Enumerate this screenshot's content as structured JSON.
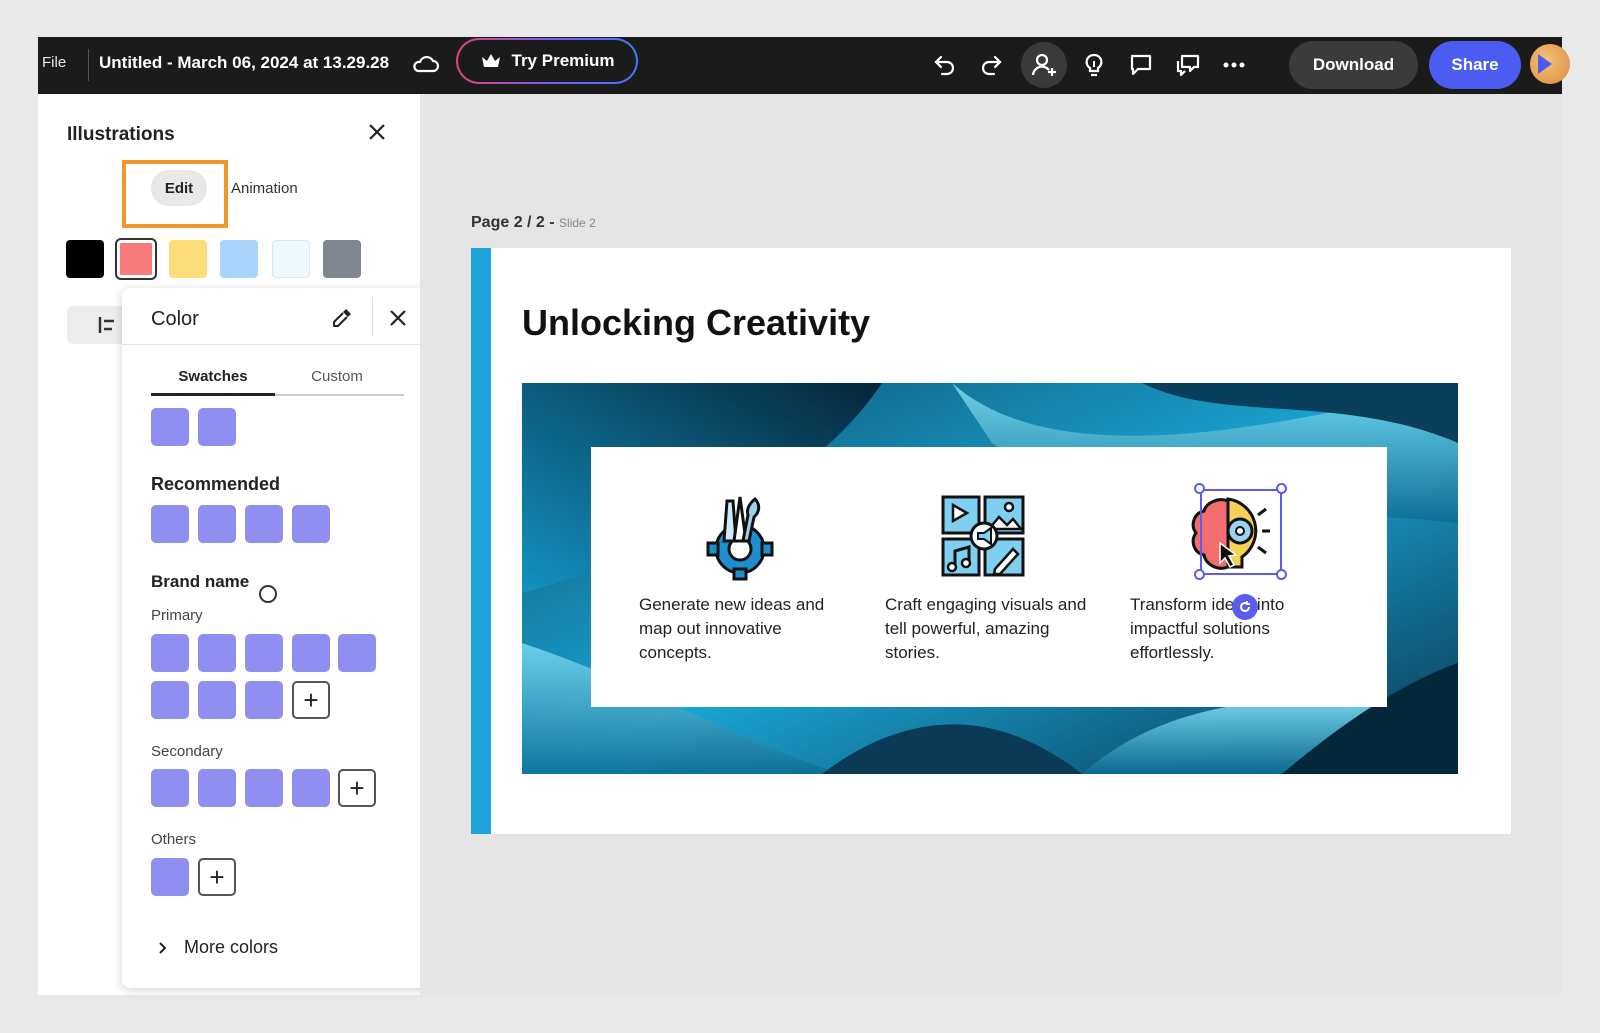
{
  "topbar": {
    "file_label": "File",
    "doc_title": "Untitled - March 06, 2024 at 13.29.28",
    "premium_label": "Try Premium",
    "download_label": "Download",
    "share_label": "Share",
    "icons": [
      "cloud-icon",
      "crown-icon",
      "undo-icon",
      "redo-icon",
      "invite-person-icon",
      "lightbulb-icon",
      "comment-icon",
      "chat-icon",
      "more-icon",
      "avatar"
    ]
  },
  "left_panel": {
    "title": "Illustrations",
    "tabs": {
      "edit": "Edit",
      "animation": "Animation"
    },
    "swatches": [
      "#000000",
      "#f77b7b",
      "#fcdd7a",
      "#a8d4fb",
      "#eef9fb",
      "#808790"
    ],
    "selected_swatch_index": 1,
    "highlight_color": "#f0962a"
  },
  "color_popup": {
    "title": "Color",
    "tabs": [
      "Swatches",
      "Custom"
    ],
    "active_tab": "Swatches",
    "swatch_color": "#8f8ff2",
    "recent_count": 2,
    "recommended": {
      "label": "Recommended",
      "count": 4
    },
    "brand": {
      "label": "Brand name",
      "primary": {
        "label": "Primary",
        "count": 8
      },
      "secondary": {
        "label": "Secondary",
        "count": 4
      },
      "others": {
        "label": "Others",
        "count": 1
      }
    },
    "more_colors": "More colors"
  },
  "canvas": {
    "page_label": "Page 2 / 2 -",
    "slide_label": "Slide 2",
    "slide": {
      "title": "Unlocking Creativity",
      "accent_color": "#1ea3dc",
      "features": [
        {
          "icon": "tools-gear-icon",
          "text": "Generate new ideas and map out innovative concepts."
        },
        {
          "icon": "media-collage-icon",
          "text": "Craft engaging visuals and tell powerful, amazing stories."
        },
        {
          "icon": "brain-idea-icon",
          "text": "Transform ideas into impactful solutions effortlessly."
        }
      ]
    }
  }
}
